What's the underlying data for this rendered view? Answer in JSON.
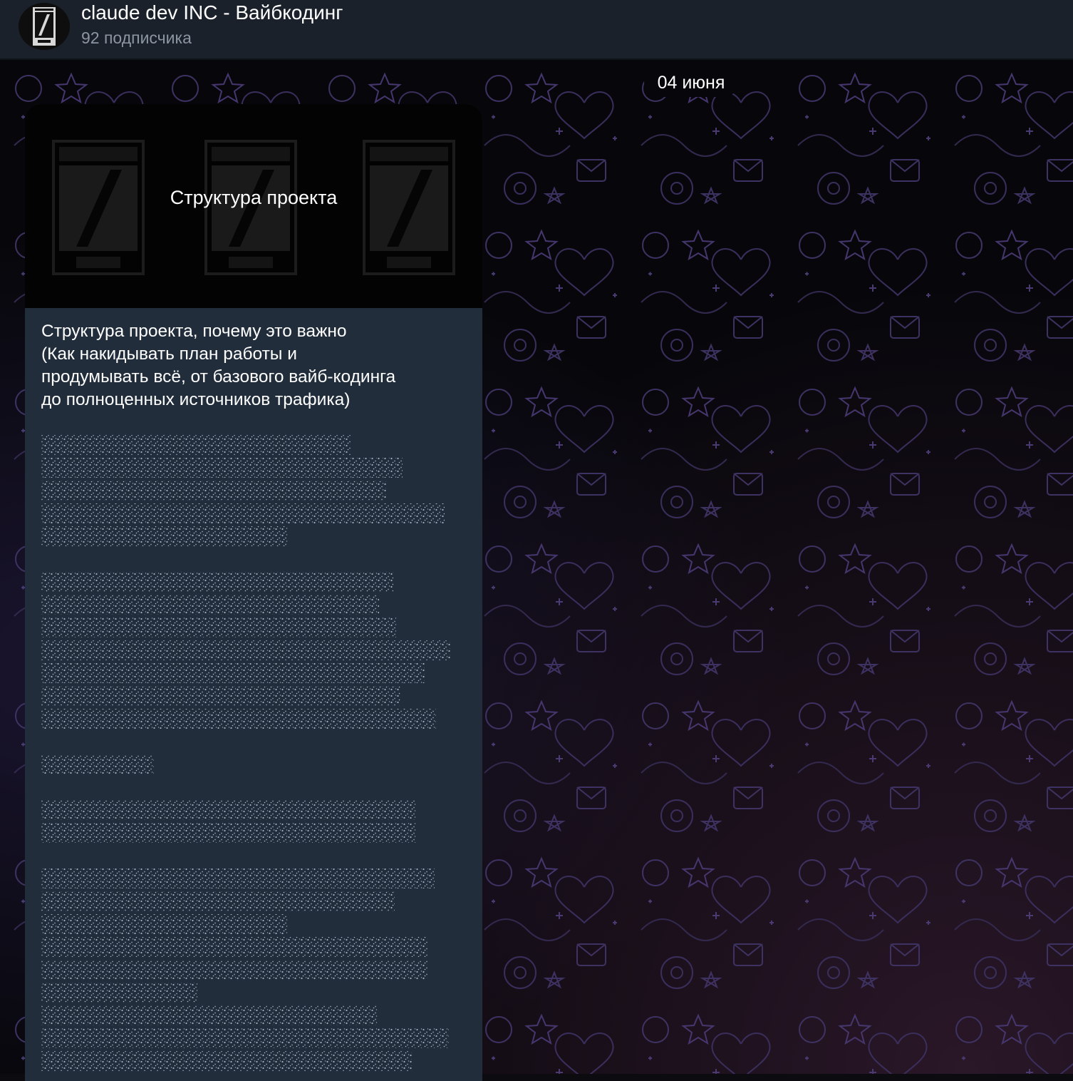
{
  "channel": {
    "title": "claude dev INC - Вайбкодинг",
    "subscribers": "92 подписчика",
    "avatar_icon": "claude-dev-inc-logo",
    "accent": "#ffffff"
  },
  "chat": {
    "date_separator": "04 июня",
    "post": {
      "media_caption": "Структура проекта",
      "logo_icon": "claude-dev-inc-logo",
      "text_lines": [
        "Структура проекта, почему это важно",
        "(Как накидывать план работы и",
        "продумывать всё, от базового вайб-кодинга",
        "до полноценных источников трафика)"
      ],
      "spoiler_icon": "hidden-spoiler-text"
    }
  },
  "colors": {
    "header_bg": "#1a212b",
    "bubble_bg": "#212d3b",
    "subtle_text": "#8c96a3",
    "spoiler_dots": "#b7c6d8"
  }
}
